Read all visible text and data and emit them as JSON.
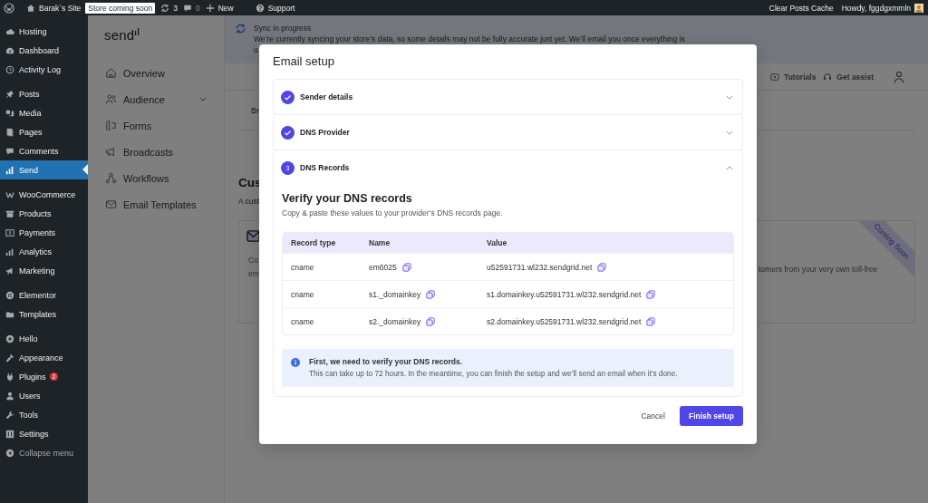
{
  "admin_bar": {
    "site_name": "Barak`s Site",
    "store_badge": "Store coming soon",
    "updates_count": "3",
    "comments_count": "0",
    "new_label": "New",
    "support_label": "Support",
    "cache_link": "Clear Posts Cache",
    "greeting": "Howdy, fggdgxmmln"
  },
  "admin_menu": {
    "groups": [
      {
        "items": [
          {
            "label": "Hosting",
            "selected": false
          },
          {
            "label": "Dashboard",
            "selected": false
          },
          {
            "label": "Activity Log",
            "selected": false
          }
        ]
      },
      {
        "items": [
          {
            "label": "Posts",
            "selected": false
          },
          {
            "label": "Media",
            "selected": false
          },
          {
            "label": "Pages",
            "selected": false
          },
          {
            "label": "Comments",
            "selected": false
          },
          {
            "label": "Send",
            "selected": true
          }
        ]
      },
      {
        "items": [
          {
            "label": "WooCommerce",
            "selected": false
          },
          {
            "label": "Products",
            "selected": false
          },
          {
            "label": "Payments",
            "selected": false
          },
          {
            "label": "Analytics",
            "selected": false
          },
          {
            "label": "Marketing",
            "selected": false
          }
        ]
      },
      {
        "items": [
          {
            "label": "Elementor",
            "selected": false
          },
          {
            "label": "Templates",
            "selected": false
          }
        ]
      },
      {
        "items": [
          {
            "label": "Hello",
            "selected": false
          },
          {
            "label": "Appearance",
            "selected": false
          },
          {
            "label": "Plugins",
            "selected": false,
            "badge": "2"
          },
          {
            "label": "Users",
            "selected": false
          },
          {
            "label": "Tools",
            "selected": false
          },
          {
            "label": "Settings",
            "selected": false
          }
        ]
      }
    ],
    "collapse_label": "Collapse menu"
  },
  "plugin_nav": {
    "logo": "send",
    "items": [
      {
        "label": "Overview",
        "kind": "link"
      },
      {
        "label": "Audience",
        "kind": "group"
      },
      {
        "label": "Forms",
        "kind": "link"
      },
      {
        "label": "Broadcasts",
        "kind": "link"
      },
      {
        "label": "Workflows",
        "kind": "link"
      },
      {
        "label": "Email Templates",
        "kind": "link"
      }
    ]
  },
  "sync_banner": {
    "title": "Sync in progress",
    "text": "We’re currently syncing your store’s data, so some details may not be fully accurate just yet. We’ll email you once everything is",
    "text_continued": "u"
  },
  "help_links": [
    {
      "label": "Tutorials"
    },
    {
      "label": "Get assist"
    }
  ],
  "page": {
    "tab_partial": "Br",
    "heading_partial": "Cus",
    "subtitle_partial": "A cust",
    "card": {
      "text_partial_lines": [
        "Co",
        "em"
      ],
      "text_right": "tomers from your very own toll-free",
      "ribbon": "Coming Soon"
    }
  },
  "modal": {
    "title": "Email setup",
    "steps": [
      {
        "label": "Sender details",
        "completed": true,
        "expanded": false
      },
      {
        "label": "DNS Provider",
        "completed": true,
        "expanded": false
      },
      {
        "label": "DNS Records",
        "completed": false,
        "number": "3",
        "expanded": true
      }
    ],
    "dns_section": {
      "heading": "Verify your DNS records",
      "description": "Copy & paste these values to your provider’s DNS records page.",
      "columns": [
        "Record type",
        "Name",
        "Value"
      ],
      "rows": [
        {
          "type": "cname",
          "name": "em6025",
          "value": "u52591731.wl232.sendgrid.net"
        },
        {
          "type": "cname",
          "name": "s1._domainkey",
          "value": "s1.domainkey.u52591731.wl232.sendgrid.net"
        },
        {
          "type": "cname",
          "name": "s2._domainkey",
          "value": "s2.domainkey.u52591731.wl232.sendgrid.net"
        }
      ],
      "notice": {
        "title": "First, we need to verify your DNS records.",
        "text": "This can take up to 72 hours. In the meantime, you can finish the setup and we’ll send an email when it’s done."
      }
    },
    "buttons": {
      "cancel": "Cancel",
      "finish": "Finish setup"
    }
  }
}
